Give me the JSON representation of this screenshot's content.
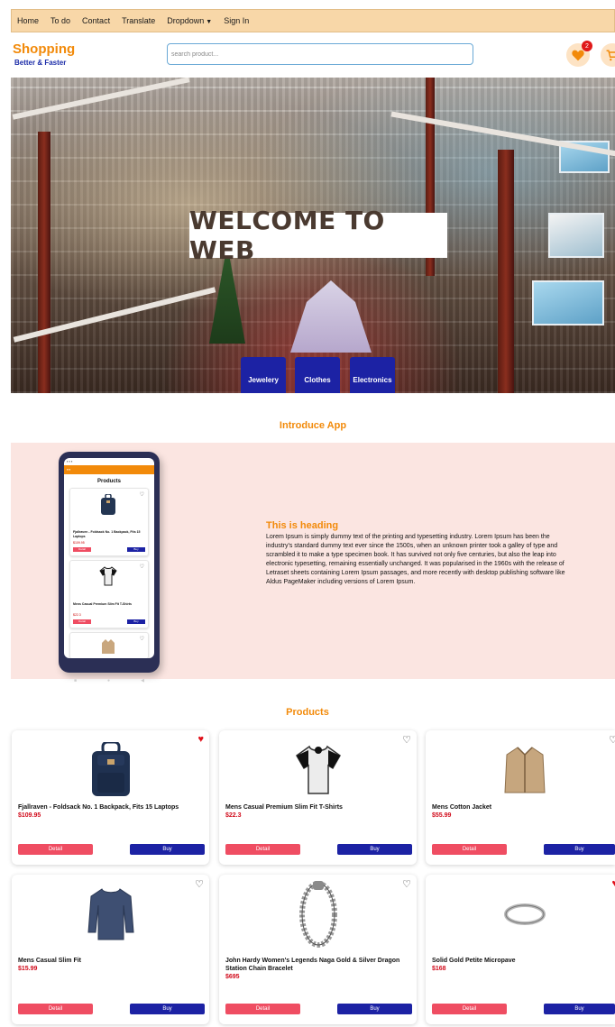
{
  "nav": {
    "items": [
      "Home",
      "To do",
      "Contact",
      "Translate",
      "Dropdown",
      "Sign In"
    ]
  },
  "header": {
    "brand": "Shopping",
    "tagline": "Better & Faster",
    "search_placeholder": "search product...",
    "wishlist_count": "2"
  },
  "hero": {
    "welcome": "WELCOME TO WEB",
    "categories": [
      "Jewelery",
      "Clothes",
      "Electronics"
    ]
  },
  "intro": {
    "section_title": "Introduce App",
    "heading": "This is heading",
    "body": "Lorem Ipsum is simply dummy text of the printing and typesetting industry. Lorem Ipsum has been the industry's standard dummy text ever since the 1500s, when an unknown printer took a galley of type and scrambled it to make a type specimen book. It has survived not only five centuries, but also the leap into electronic typesetting, remaining essentially unchanged. It was popularised in the 1960s with the release of Letraset sheets containing Lorem Ipsum passages, and more recently with desktop publishing software like Aldus PageMaker including versions of Lorem Ipsum.",
    "phone": {
      "app_title": "Products",
      "items": [
        {
          "name": "Fjallraven - Foldsack No. 1 Backpack, Fits 15 Laptops",
          "price": "$109.95"
        },
        {
          "name": "Mens Casual Premium Slim Fit T-Shirts",
          "price": "$22.3"
        }
      ],
      "detail_label": "Detail",
      "buy_label": "Buy"
    }
  },
  "products": {
    "section_title": "Products",
    "detail_label": "Detail",
    "buy_label": "Buy",
    "items": [
      {
        "name": "Fjallraven - Foldsack No. 1 Backpack, Fits 15 Laptops",
        "price": "$109.95",
        "liked": true,
        "icon": "backpack-icon"
      },
      {
        "name": "Mens Casual Premium Slim Fit T-Shirts",
        "price": "$22.3",
        "liked": false,
        "icon": "tshirt-icon"
      },
      {
        "name": "Mens Cotton Jacket",
        "price": "$55.99",
        "liked": false,
        "icon": "jacket-icon"
      },
      {
        "name": "Mens Casual Slim Fit",
        "price": "$15.99",
        "liked": false,
        "icon": "longsleeve-shirt-icon"
      },
      {
        "name": "John Hardy Women's Legends Naga Gold & Silver Dragon Station Chain Bracelet",
        "price": "$695",
        "liked": false,
        "icon": "bracelet-icon"
      },
      {
        "name": "Solid Gold Petite Micropave",
        "price": "$168",
        "liked": true,
        "icon": "ring-icon"
      }
    ]
  },
  "colors": {
    "accent": "#f28a0a",
    "brand_blue": "#1c22a4",
    "detail_red": "#ef4d62",
    "price_red": "#d10a1a",
    "nav_bg": "#f8d7a8",
    "intro_bg": "#fbe5e1"
  }
}
